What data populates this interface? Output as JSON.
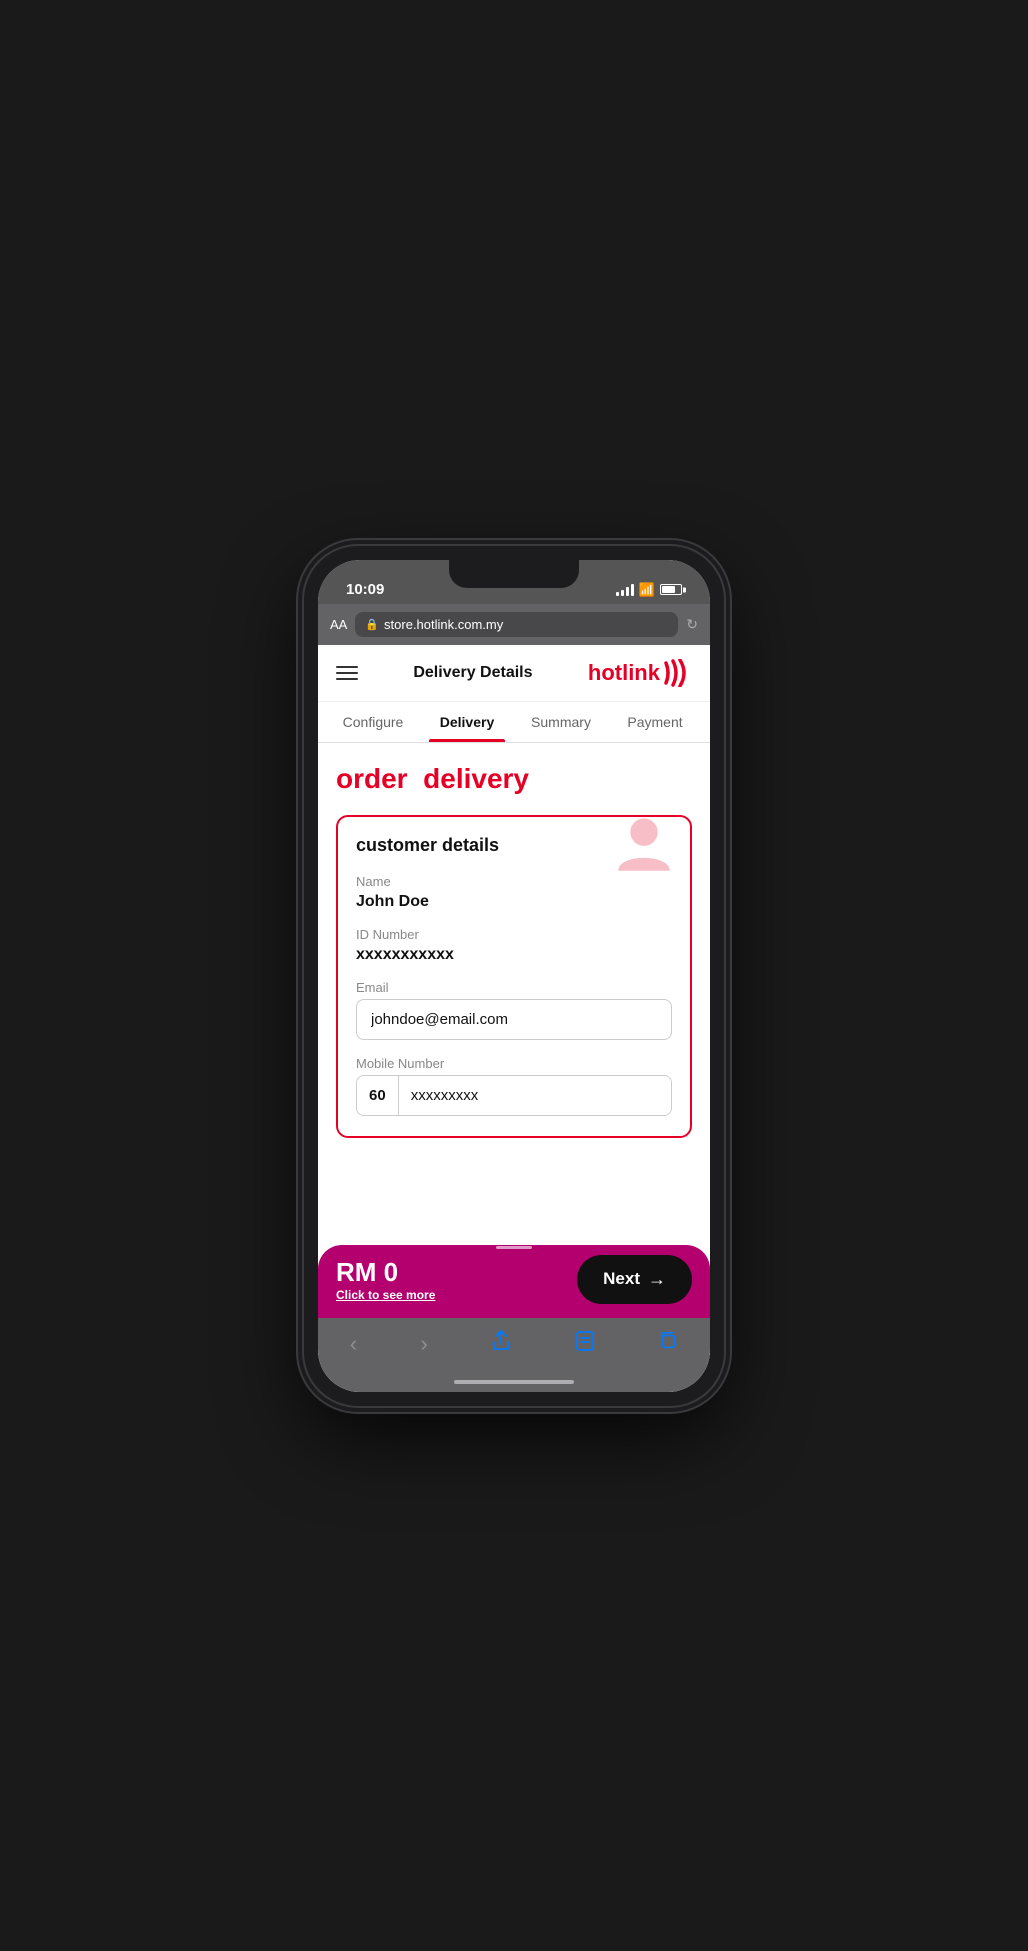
{
  "status": {
    "time": "10:09"
  },
  "browser": {
    "aa_label": "AA",
    "url": "store.hotlink.com.my"
  },
  "header": {
    "title": "Delivery Details",
    "logo": "hotlink"
  },
  "tabs": [
    {
      "label": "Configure",
      "active": false
    },
    {
      "label": "Delivery",
      "active": true
    },
    {
      "label": "Summary",
      "active": false
    },
    {
      "label": "Payment",
      "active": false
    }
  ],
  "page": {
    "heading_black": "order",
    "heading_red": "delivery"
  },
  "customer_details": {
    "title": "customer details",
    "name_label": "Name",
    "name_value": "John Doe",
    "id_label": "ID Number",
    "id_value": "xxxxxxxxxxx",
    "email_label": "Email",
    "email_value": "johndoe@email.com",
    "mobile_label": "Mobile Number",
    "country_code": "60",
    "mobile_value": "xxxxxxxxx"
  },
  "bottom_bar": {
    "price": "RM 0",
    "click_more": "Click to see more",
    "next_label": "Next"
  },
  "safari_nav": {
    "back": "‹",
    "forward": "›",
    "share": "⬆",
    "bookmarks": "📖",
    "tabs": "⧉"
  }
}
